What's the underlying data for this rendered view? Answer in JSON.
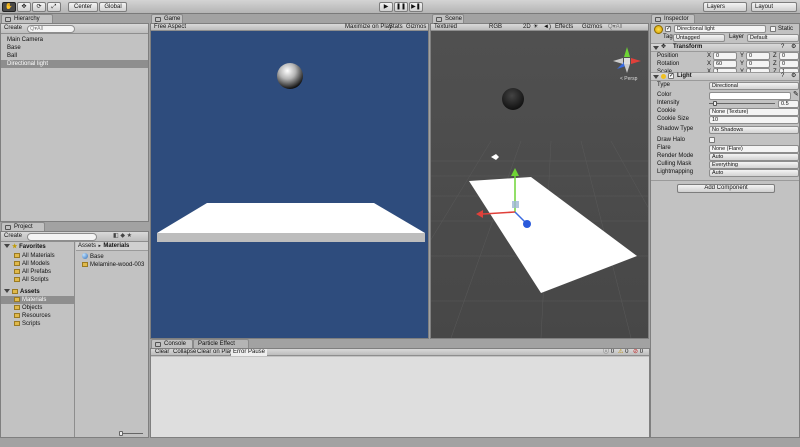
{
  "toolbar": {
    "tools": [
      "hand",
      "move",
      "rotate",
      "scale"
    ],
    "pivot_label": "Center",
    "space_label": "Global",
    "layers_label": "Layers",
    "layout_label": "Layout"
  },
  "hierarchy": {
    "tab": "Hierarchy",
    "create_label": "Create",
    "search_placeholder": "Q▾All",
    "items": [
      "Main Camera",
      "Base",
      "Ball",
      "Directional light"
    ],
    "selected_index": 3
  },
  "game": {
    "tab": "Game",
    "aspect": "Free Aspect",
    "maximize_label": "Maximize on Play",
    "stats_label": "Stats",
    "gizmos_label": "Gizmos"
  },
  "scene": {
    "tab": "Scene",
    "shading": "Textured",
    "color_mode": "RGB",
    "mode_2d": "2D",
    "effects_label": "Effects",
    "gizmos_label": "Gizmos",
    "search_placeholder": "Q▾All",
    "persp_label": "< Persp"
  },
  "inspector": {
    "tab": "Inspector",
    "object_name": "Directional light",
    "static_label": "Static",
    "tag_label": "Tag",
    "tag_value": "Untagged",
    "layer_label": "Layer",
    "layer_value": "Default",
    "transform": {
      "title": "Transform",
      "rows": [
        {
          "label": "Position",
          "x": "0",
          "y": "0",
          "z": "0"
        },
        {
          "label": "Rotation",
          "x": "60",
          "y": "0",
          "z": "0"
        },
        {
          "label": "Scale",
          "x": "1",
          "y": "1",
          "z": "1"
        }
      ]
    },
    "light": {
      "title": "Light",
      "type_label": "Type",
      "type_value": "Directional",
      "color_label": "Color",
      "intensity_label": "Intensity",
      "intensity_value": "0.5",
      "intensity_fraction": 0.0625,
      "cookie_label": "Cookie",
      "cookie_value": "None (Texture)",
      "cookie_size_label": "Cookie Size",
      "cookie_size_value": "10",
      "shadow_type_label": "Shadow Type",
      "shadow_type_value": "No Shadows",
      "draw_halo_label": "Draw Halo",
      "flare_label": "Flare",
      "flare_value": "None (Flare)",
      "render_mode_label": "Render Mode",
      "render_mode_value": "Auto",
      "culling_mask_label": "Culling Mask",
      "culling_mask_value": "Everything",
      "lightmapping_label": "Lightmapping",
      "lightmapping_value": "Auto"
    },
    "add_component_label": "Add Component"
  },
  "project": {
    "tab": "Project",
    "create_label": "Create",
    "favorites_label": "Favorites",
    "favorites": [
      "All Materials",
      "All Models",
      "All Prefabs",
      "All Scripts"
    ],
    "assets_label": "Assets",
    "asset_folders": [
      "Materials",
      "Objects",
      "Resources",
      "Scripts"
    ],
    "selected_folder_index": 0,
    "breadcrumb_root": "Assets",
    "breadcrumb_sep": "►",
    "breadcrumb_leaf": "Materials",
    "files": [
      {
        "name": "Base",
        "kind": "material"
      },
      {
        "name": "Melamine-wood-003",
        "kind": "folder"
      }
    ]
  },
  "console": {
    "tab": "Console",
    "tab2": "Particle Effect",
    "clear_label": "Clear",
    "collapse_label": "Collapse",
    "clear_on_play_label": "Clear on Play",
    "error_pause_label": "Error Pause",
    "counts": [
      "0",
      "0",
      "0"
    ]
  },
  "colors": {
    "game_bg": "#2e4c7d",
    "scene_bg": "#4a4a4a",
    "selection": "#8e8e8e"
  }
}
